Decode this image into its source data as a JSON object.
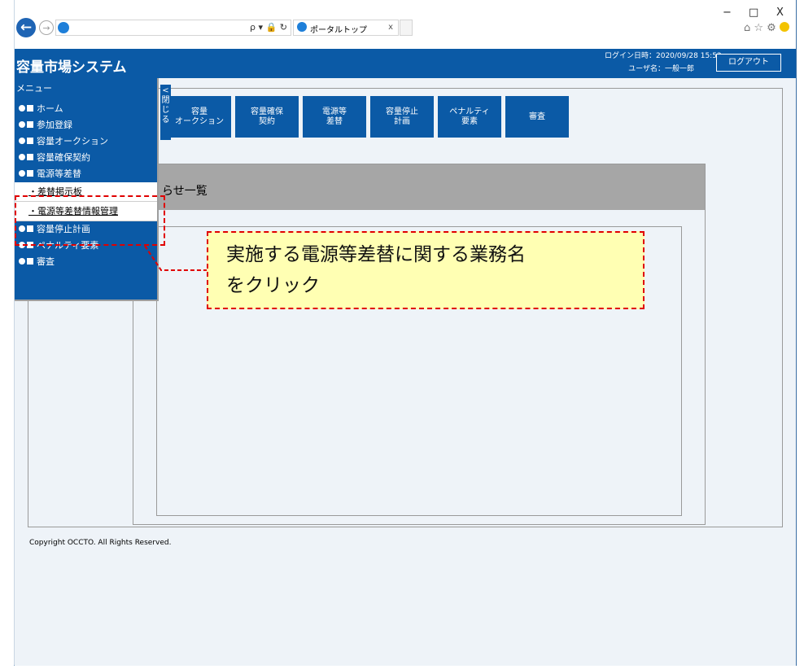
{
  "browser": {
    "address_tools": "ρ ▾ 🔒 ↻",
    "tab_title": "ポータルトップ",
    "tab_close": "x",
    "window_controls": [
      "−",
      "□",
      "X"
    ],
    "toolbar_icons": "⌂ ☆ ⚙"
  },
  "app": {
    "title": "容量市場システム",
    "login_time": "ログイン日時：2020/09/28 15:52",
    "user_name": "ユーザ名：一般一郎",
    "logout_label": "ログアウト"
  },
  "menu": {
    "title": "メニュー",
    "close_label": "<\n閉\nじ\nる",
    "items": [
      {
        "label": "ホーム"
      },
      {
        "label": "参加登録"
      },
      {
        "label": "容量オークション"
      },
      {
        "label": "容量確保契約"
      },
      {
        "label": "電源等差替"
      },
      {
        "label": "容量停止計画"
      },
      {
        "label": "ペナルティ要素"
      },
      {
        "label": "審査"
      }
    ],
    "subitems": [
      {
        "label": "・差替掲示板"
      },
      {
        "label": "・電源等差替情報管理"
      }
    ]
  },
  "nav_buttons": [
    {
      "label": "容量\nオークション"
    },
    {
      "label": "容量確保\n契約"
    },
    {
      "label": "電源等\n差替"
    },
    {
      "label": "容量停止\n計画"
    },
    {
      "label": "ペナルティ\n要素"
    },
    {
      "label": "審査"
    }
  ],
  "notice": {
    "title": "らせ一覧"
  },
  "footer": {
    "copyright": "Copyright OCCTO. All Rights Reserved."
  },
  "callout": {
    "text": "実施する電源等差替に関する業務名\nをクリック"
  },
  "colors": {
    "brand": "#0b5aa6",
    "highlight": "#e00000",
    "callout_bg": "#ffffb3"
  }
}
